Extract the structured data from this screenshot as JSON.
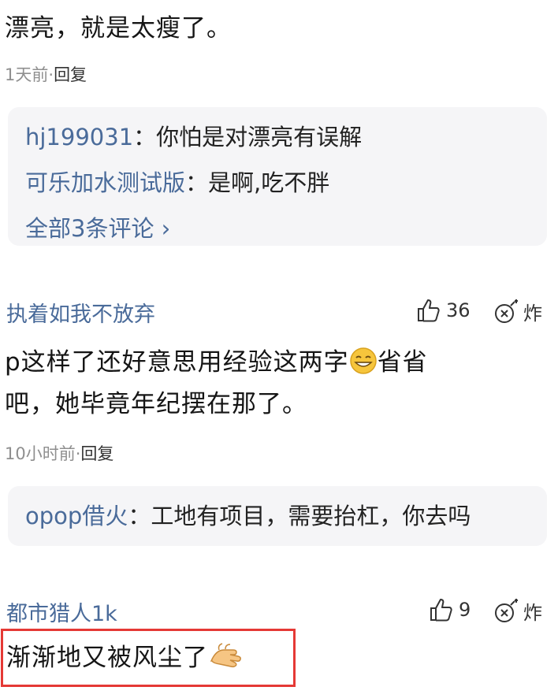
{
  "comment1": {
    "text": "漂亮，就是太瘦了。",
    "time": "1天前",
    "dot": "·",
    "reply_label": "回复",
    "replies": [
      {
        "name": "hj199031",
        "sep": "：",
        "text": "你怕是对漂亮有误解"
      },
      {
        "name": "可乐加水测试版",
        "sep": "：",
        "text": "是啊,吃不胖"
      }
    ],
    "all_replies": "全部3条评论",
    "all_replies_arrow": "›"
  },
  "comment2": {
    "author": "执着如我不放弃",
    "likes": "36",
    "bomb_label": "炸",
    "text_line1": "p这样了还好意思用经验这两字",
    "text_line1_after": "省省",
    "text_line2": "吧，她毕竟年纪摆在那了。",
    "emoji": "grin-emoji",
    "time": "10小时前",
    "dot": "·",
    "reply_label": "回复",
    "replies": [
      {
        "name": "opop借火",
        "sep": "：",
        "text": "工地有项目，需要抬杠，你去吗"
      }
    ]
  },
  "comment3": {
    "author": "都市猎人1k",
    "likes": "9",
    "bomb_label": "炸",
    "text": "渐渐地又被风尘了",
    "emoji": "clap-emoji"
  },
  "colors": {
    "link": "#4a6b9a",
    "highlight": "#e53935",
    "reply_bg": "#f5f5f7",
    "meta": "#8f8f8f"
  }
}
